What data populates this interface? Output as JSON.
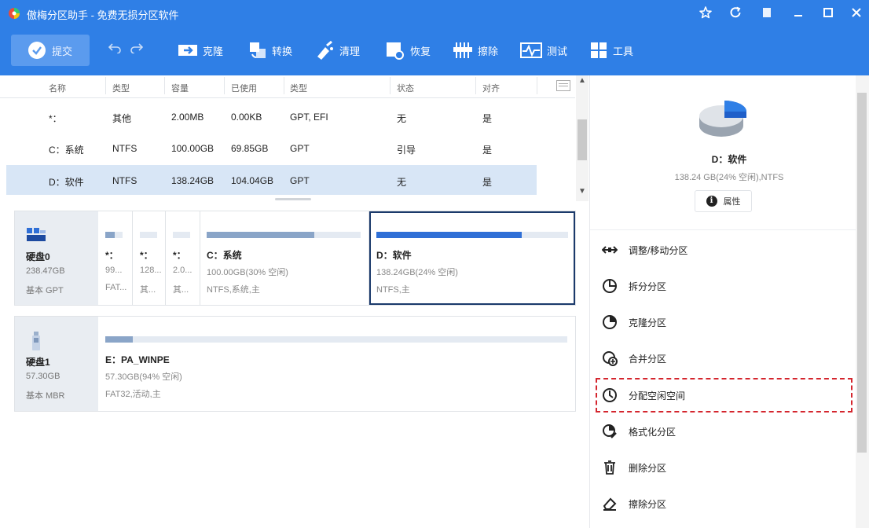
{
  "app": {
    "title": "傲梅分区助手 - 免费无损分区软件",
    "brand_color": "#2f7fe6",
    "window_buttons": [
      "star-icon",
      "refresh-icon",
      "menu-icon",
      "minimize-icon",
      "maximize-icon",
      "close-icon"
    ]
  },
  "toolbar": {
    "commit_label": "提交",
    "undo_icon": "undo-icon",
    "redo_icon": "redo-icon",
    "tools": [
      {
        "label": "克隆",
        "icon": "clone-icon"
      },
      {
        "label": "转换",
        "icon": "convert-icon"
      },
      {
        "label": "清理",
        "icon": "clean-icon"
      },
      {
        "label": "恢复",
        "icon": "recover-icon"
      },
      {
        "label": "擦除",
        "icon": "wipe-icon"
      },
      {
        "label": "测试",
        "icon": "test-icon"
      },
      {
        "label": "工具",
        "icon": "tools-icon"
      }
    ]
  },
  "table": {
    "columns": [
      "名称",
      "类型",
      "容量",
      "已使用",
      "类型",
      "状态",
      "对齐"
    ],
    "rows": [
      {
        "name": "*：",
        "fs": "其他",
        "capacity": "2.00MB",
        "used": "0.00KB",
        "type": "GPT, EFI",
        "status": "无",
        "aligned": "是",
        "selected": false
      },
      {
        "name": "C：系统",
        "fs": "NTFS",
        "capacity": "100.00GB",
        "used": "69.85GB",
        "type": "GPT",
        "status": "引导",
        "aligned": "是",
        "selected": false
      },
      {
        "name": "D：软件",
        "fs": "NTFS",
        "capacity": "138.24GB",
        "used": "104.04GB",
        "type": "GPT",
        "status": "无",
        "aligned": "是",
        "selected": true
      }
    ]
  },
  "disks": [
    {
      "name": "硬盘0",
      "size": "238.47GB",
      "style": "基本 GPT",
      "icon": "hdd-icon",
      "partitions": [
        {
          "label": "*：",
          "line1": "99...",
          "line2": "FAT...",
          "fill": 0.55,
          "selected": false
        },
        {
          "label": "*：",
          "line1": "128...",
          "line2": "其...",
          "fill": 0.0,
          "selected": false
        },
        {
          "label": "*：",
          "line1": "2.0...",
          "line2": "其...",
          "fill": 0.0,
          "selected": false
        },
        {
          "label": "C：系统",
          "line1": "100.00GB(30% 空闲)",
          "line2": "NTFS,系统,主",
          "fill": 0.7,
          "selected": false
        },
        {
          "label": "D：软件",
          "line1": "138.24GB(24% 空闲)",
          "line2": "NTFS,主",
          "fill": 0.76,
          "selected": true
        }
      ]
    },
    {
      "name": "硬盘1",
      "size": "57.30GB",
      "style": "基本 MBR",
      "icon": "usb-drive-icon",
      "partitions": [
        {
          "label": "E：PA_WINPE",
          "line1": "57.30GB(94% 空闲)",
          "line2": "FAT32,活动,主",
          "fill": 0.06,
          "selected": false
        }
      ]
    }
  ],
  "details": {
    "title": "D：软件",
    "subtitle": "138.24 GB(24% 空闲),NTFS",
    "properties_label": "属性",
    "used_fraction": 0.76,
    "actions": [
      {
        "label": "调整/移动分区",
        "icon": "resize-icon"
      },
      {
        "label": "拆分分区",
        "icon": "split-icon"
      },
      {
        "label": "克隆分区",
        "icon": "clone-partition-icon"
      },
      {
        "label": "合并分区",
        "icon": "merge-icon"
      },
      {
        "label": "分配空闲空间",
        "icon": "allocate-icon",
        "highlighted": true
      },
      {
        "label": "格式化分区",
        "icon": "format-icon"
      },
      {
        "label": "删除分区",
        "icon": "delete-icon"
      },
      {
        "label": "擦除分区",
        "icon": "erase-icon"
      }
    ]
  }
}
